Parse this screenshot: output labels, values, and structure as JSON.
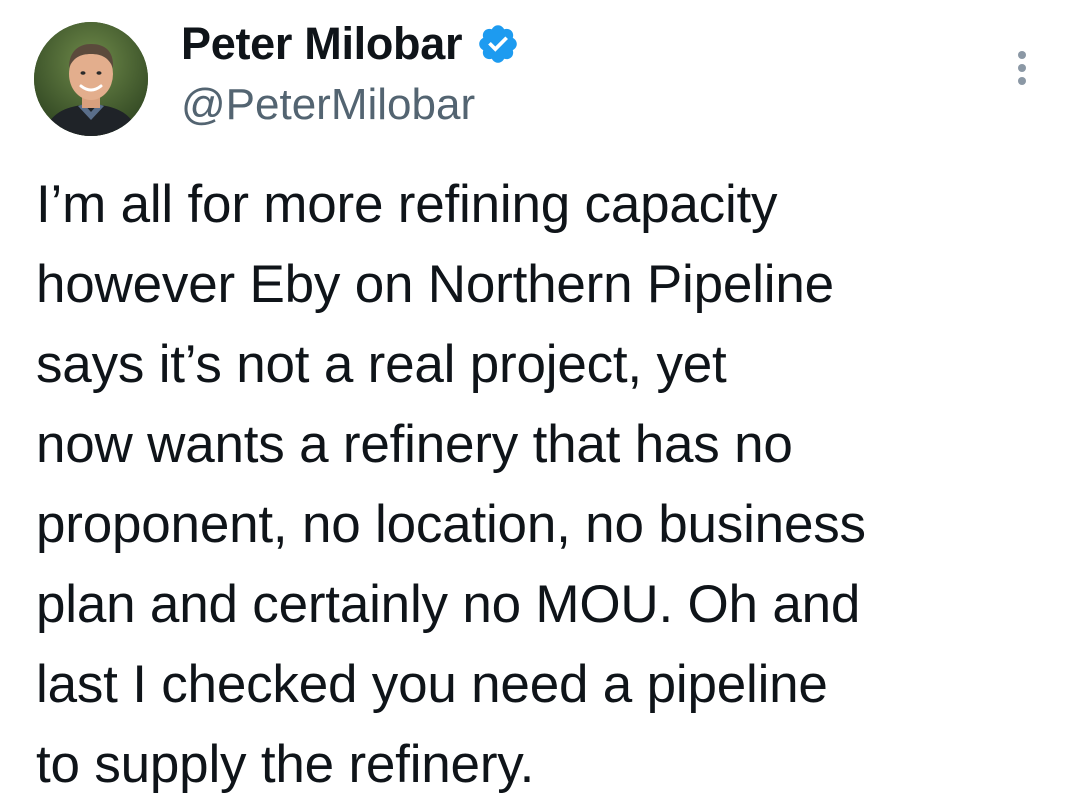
{
  "author": {
    "display_name": "Peter Milobar",
    "handle": "@PeterMilobar",
    "verified": true,
    "avatar_icon": "profile-photo",
    "verified_icon": "verified-badge-icon",
    "verified_color": "#1d9bf0"
  },
  "menu": {
    "icon": "more-options-icon"
  },
  "tweet": {
    "lines": [
      "I’m all for more refining capacity",
      "however Eby on Northern Pipeline",
      "says it’s not a real project, yet",
      "now wants a refinery that has no",
      "proponent, no location, no business",
      "plan and certainly no MOU. Oh and",
      "last I checked you need a pipeline",
      "to supply the refinery."
    ]
  }
}
